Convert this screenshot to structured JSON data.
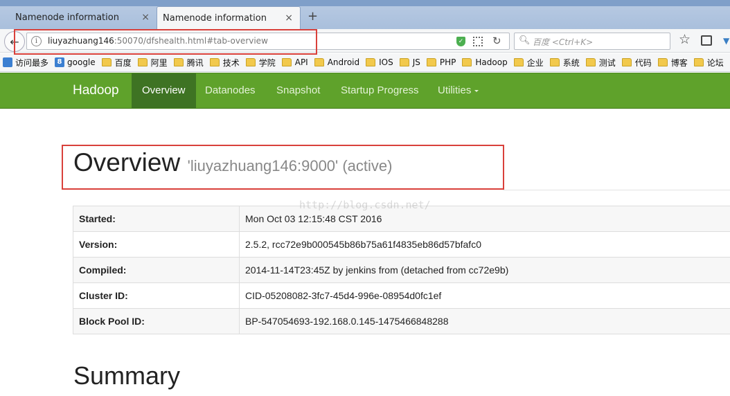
{
  "browser": {
    "tabs": [
      {
        "title": "Namenode information",
        "active": false
      },
      {
        "title": "Namenode information",
        "active": true
      }
    ],
    "close_glyph": "×",
    "new_tab_glyph": "+",
    "url_host": "liuyazhuang146",
    "url_rest": ":50070/dfshealth.html#tab-overview",
    "search_placeholder": "百度 <Ctrl+K>",
    "icons": {
      "back": "back-arrow-icon",
      "info": "info-icon",
      "shield": "shield-icon",
      "qr": "qr-code-icon",
      "reload": "reload-icon",
      "search": "search-icon",
      "bookmark_star": "star-icon",
      "reader": "reader-icon"
    }
  },
  "bookmarks": [
    {
      "label": "访问最多",
      "icon": "blue"
    },
    {
      "label": "google",
      "icon": "blue"
    },
    {
      "label": "百度",
      "icon": "folder"
    },
    {
      "label": "阿里",
      "icon": "folder"
    },
    {
      "label": "腾讯",
      "icon": "folder"
    },
    {
      "label": "技术",
      "icon": "folder"
    },
    {
      "label": "学院",
      "icon": "folder"
    },
    {
      "label": "API",
      "icon": "folder"
    },
    {
      "label": "Android",
      "icon": "folder"
    },
    {
      "label": "IOS",
      "icon": "folder"
    },
    {
      "label": "JS",
      "icon": "folder"
    },
    {
      "label": "PHP",
      "icon": "folder"
    },
    {
      "label": "Hadoop",
      "icon": "folder"
    },
    {
      "label": "企业",
      "icon": "folder"
    },
    {
      "label": "系统",
      "icon": "folder"
    },
    {
      "label": "测试",
      "icon": "folder"
    },
    {
      "label": "代码",
      "icon": "folder"
    },
    {
      "label": "博客",
      "icon": "folder"
    },
    {
      "label": "论坛",
      "icon": "folder"
    }
  ],
  "hadoop_nav": {
    "brand": "Hadoop",
    "items": [
      {
        "label": "Overview",
        "active": true
      },
      {
        "label": "Datanodes",
        "active": false
      },
      {
        "label": "Snapshot",
        "active": false
      },
      {
        "label": "Startup Progress",
        "active": false
      },
      {
        "label": "Utilities",
        "active": false,
        "dropdown": true
      }
    ],
    "colors": {
      "bar": "#5fa22b",
      "active": "#3e7323"
    }
  },
  "overview": {
    "heading": "Overview",
    "subheading": "'liuyazhuang146:9000' (active)",
    "rows": [
      {
        "key": "Started:",
        "value": "Mon Oct 03 12:15:48 CST 2016"
      },
      {
        "key": "Version:",
        "value": "2.5.2, rcc72e9b000545b86b75a61f4835eb86d57bfafc0"
      },
      {
        "key": "Compiled:",
        "value": "2014-11-14T23:45Z by jenkins from (detached from cc72e9b)"
      },
      {
        "key": "Cluster ID:",
        "value": "CID-05208082-3fc7-45d4-996e-08954d0fc1ef"
      },
      {
        "key": "Block Pool ID:",
        "value": "BP-547054693-192.168.0.145-1475466848288"
      }
    ]
  },
  "watermark": "http://blog.csdn.net/",
  "summary_heading": "Summary",
  "annotation_color": "#d9403a"
}
